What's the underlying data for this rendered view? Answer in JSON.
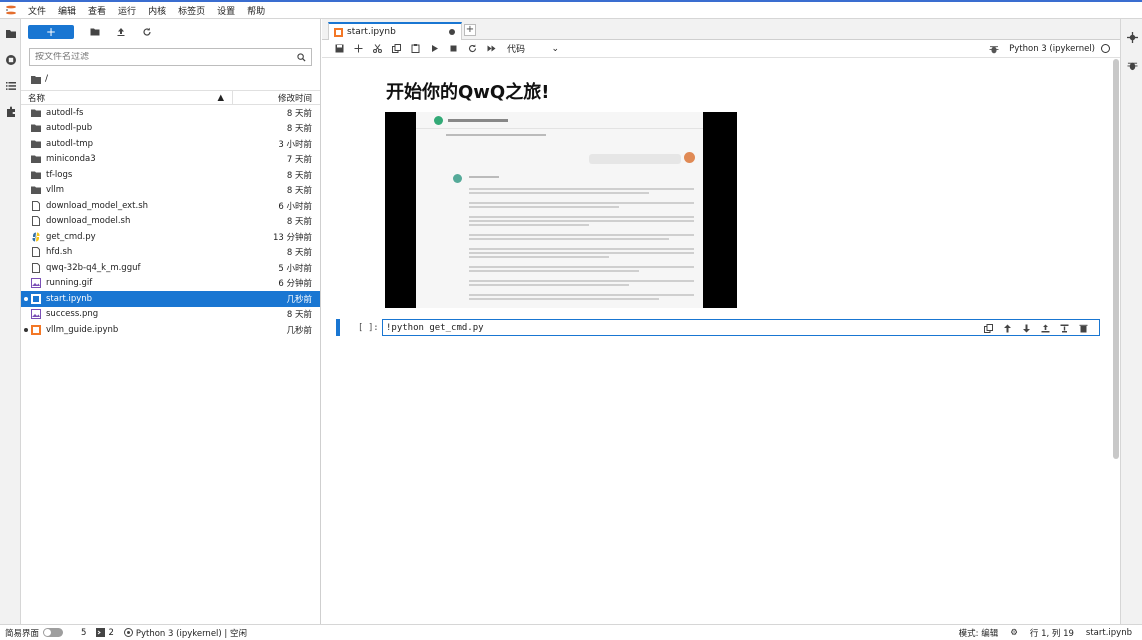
{
  "menu": [
    "文件",
    "编辑",
    "查看",
    "运行",
    "内核",
    "标签页",
    "设置",
    "帮助"
  ],
  "filebrowser": {
    "new_label": "+",
    "filter_placeholder": "按文件名过滤",
    "path": "/",
    "col_name": "名称",
    "col_modified": "修改时间",
    "files": [
      {
        "name": "autodl-fs",
        "time": "8 天前",
        "type": "folder"
      },
      {
        "name": "autodl-pub",
        "time": "8 天前",
        "type": "folder"
      },
      {
        "name": "autodl-tmp",
        "time": "3 小时前",
        "type": "folder"
      },
      {
        "name": "miniconda3",
        "time": "7 天前",
        "type": "folder"
      },
      {
        "name": "tf-logs",
        "time": "8 天前",
        "type": "folder"
      },
      {
        "name": "vllm",
        "time": "8 天前",
        "type": "folder"
      },
      {
        "name": "download_model_ext.sh",
        "time": "6 小时前",
        "type": "file"
      },
      {
        "name": "download_model.sh",
        "time": "8 天前",
        "type": "file"
      },
      {
        "name": "get_cmd.py",
        "time": "13 分钟前",
        "type": "python"
      },
      {
        "name": "hfd.sh",
        "time": "8 天前",
        "type": "file"
      },
      {
        "name": "qwq-32b-q4_k_m.gguf",
        "time": "5 小时前",
        "type": "file"
      },
      {
        "name": "running.gif",
        "time": "6 分钟前",
        "type": "image"
      },
      {
        "name": "start.ipynb",
        "time": "几秒前",
        "type": "notebook",
        "selected": true,
        "running": true
      },
      {
        "name": "success.png",
        "time": "8 天前",
        "type": "image"
      },
      {
        "name": "vllm_guide.ipynb",
        "time": "几秒前",
        "type": "notebook-orange",
        "running": true
      }
    ]
  },
  "tab": {
    "name": "start.ipynb"
  },
  "notebook": {
    "cell_type": "代码",
    "kernel": "Python 3 (ipykernel)",
    "heading": "开始你的QwQ之旅!",
    "prompt": "[ ]:",
    "code": "!python get_cmd.py"
  },
  "status": {
    "simple_mode": "简易界面",
    "count1": "5",
    "count2": "2",
    "kernel_status": "Python 3 (ipykernel) | 空闲",
    "mode": "模式: 编辑",
    "position": "行 1, 列 19",
    "filename": "start.ipynb"
  },
  "colors": {
    "accent": "#1976d2"
  }
}
